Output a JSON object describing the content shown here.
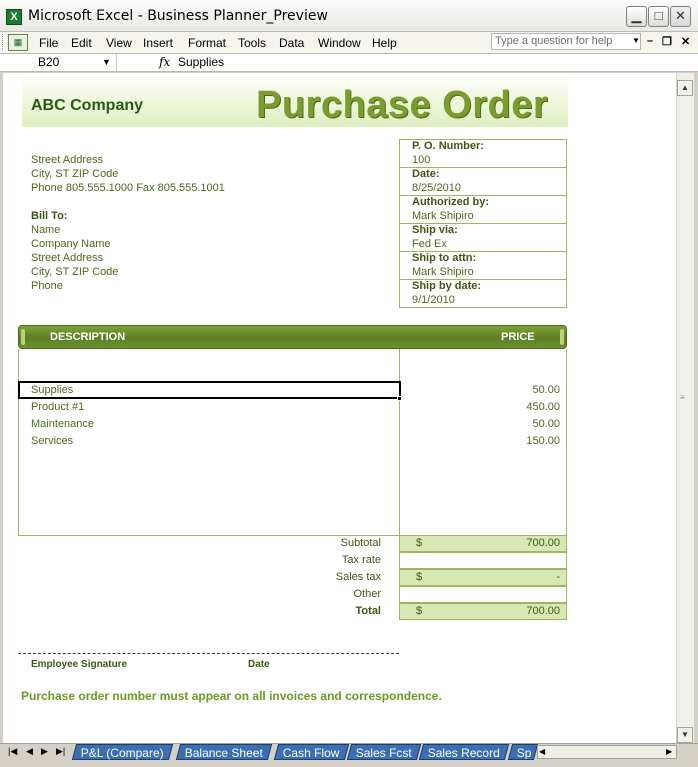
{
  "window": {
    "title": "Microsoft Excel - Business Planner_Preview",
    "app_icon": "excel-icon",
    "buttons": [
      "minimize",
      "maximize",
      "close"
    ]
  },
  "menu": {
    "items": [
      "File",
      "Edit",
      "View",
      "Insert",
      "Format",
      "Tools",
      "Data",
      "Window",
      "Help"
    ],
    "ask_placeholder": "Type a question for help"
  },
  "formula_bar": {
    "cell_ref": "B20",
    "fx": "fx",
    "content": "Supplies"
  },
  "doc": {
    "company": "ABC Company",
    "title": "Purchase Order",
    "address": [
      "Street Address",
      "City, ST  ZIP Code",
      "Phone 805.555.1000    Fax 805.555.1001"
    ],
    "bill_to_label": "Bill To:",
    "bill_to": [
      "Name",
      "Company Name",
      "Street Address",
      "City, ST  ZIP Code",
      "Phone"
    ],
    "po_fields": [
      {
        "label": "P. O. Number:",
        "value": "100"
      },
      {
        "label": "Date:",
        "value": "8/25/2010"
      },
      {
        "label": "Authorized by:",
        "value": "Mark Shipiro"
      },
      {
        "label": "Ship via:",
        "value": "Fed Ex"
      },
      {
        "label": "Ship to attn:",
        "value": "Mark Shipiro"
      },
      {
        "label": "Ship by date:",
        "value": "9/1/2010"
      }
    ],
    "table": {
      "header_description": "DESCRIPTION",
      "header_price": "PRICE",
      "rows": [
        {
          "description": "Supplies",
          "price": "50.00"
        },
        {
          "description": "Product #1",
          "price": "450.00"
        },
        {
          "description": "Maintenance",
          "price": "50.00"
        },
        {
          "description": "Services",
          "price": "150.00"
        }
      ]
    },
    "totals": [
      {
        "label": "Subtotal",
        "dollar": "$",
        "value": "700.00"
      },
      {
        "label": "Tax rate",
        "dollar": "",
        "value": ""
      },
      {
        "label": "Sales tax",
        "dollar": "$",
        "value": "-"
      },
      {
        "label": "Other",
        "dollar": "",
        "value": ""
      },
      {
        "label": "Total",
        "dollar": "$",
        "value": "700.00"
      }
    ],
    "signature_label": "Employee Signature",
    "date_label": "Date",
    "notice": "Purchase order number must appear on all invoices and correspondence."
  },
  "sheet_tabs": [
    "P&L (Compare)",
    "Balance Sheet",
    "Cash Flow",
    "Sales Fcst",
    "Sales Record",
    "Sp"
  ],
  "colors": {
    "accent_green": "#6a9b24",
    "header_green": "#5c7e22",
    "fill_green": "#d7e8b4",
    "tab_blue": "#3c6eb4"
  }
}
